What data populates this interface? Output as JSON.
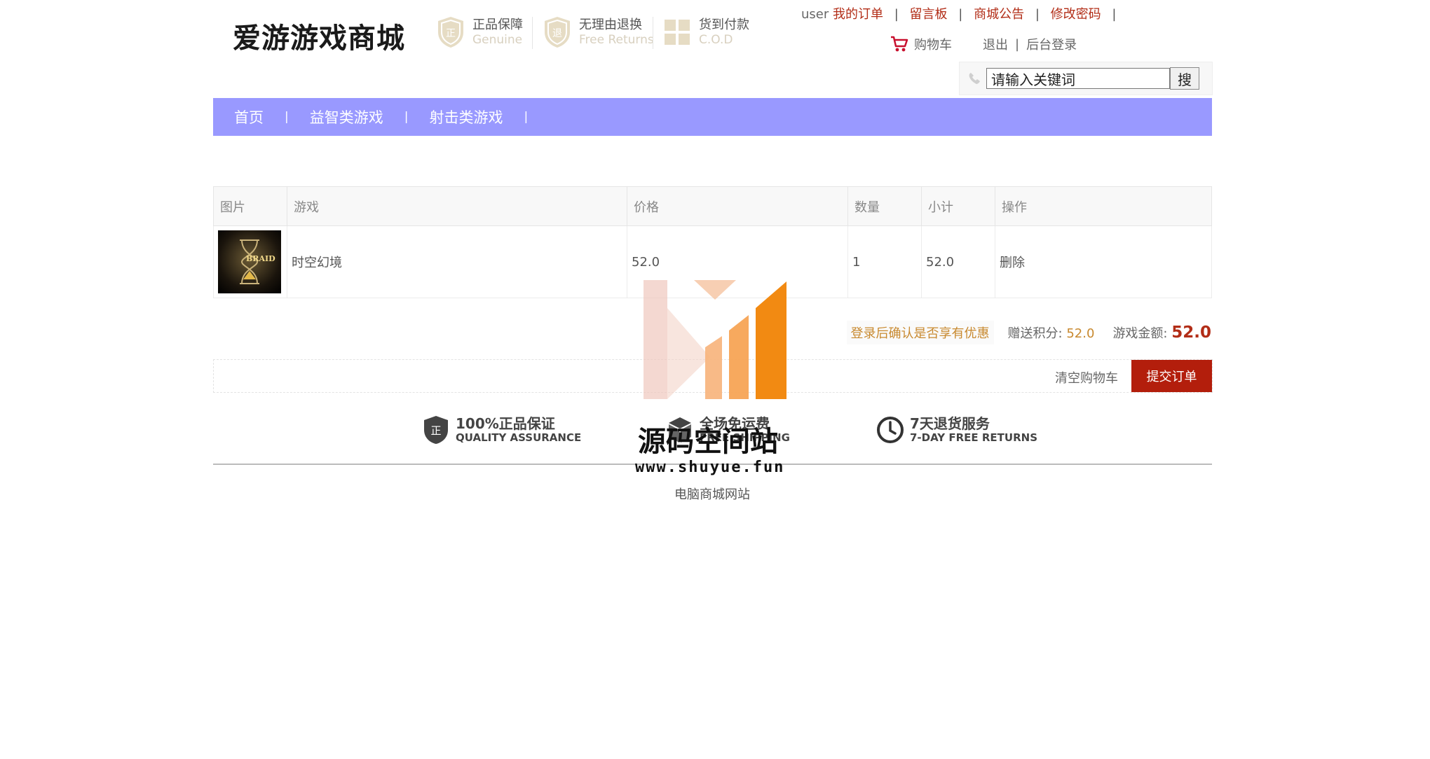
{
  "header": {
    "logo_text": "爱游游戏商城",
    "promises": [
      {
        "title": "正品保障",
        "subtitle": "Genuine"
      },
      {
        "title": "无理由退换",
        "subtitle": "Free Returns"
      },
      {
        "title": "货到付款",
        "subtitle": "C.O.D"
      }
    ],
    "user_links": {
      "username": "user",
      "my_orders": "我的订单",
      "message_board": "留言板",
      "announcements": "商城公告",
      "change_password": "修改密码",
      "separator": "|"
    },
    "cart_label": "购物车",
    "logout": "退出",
    "admin_login": "后台登录"
  },
  "search": {
    "value": "请输入关键词",
    "button_label": "搜"
  },
  "nav": {
    "items": [
      "首页",
      "益智类游戏",
      "射击类游戏"
    ],
    "separator": "|"
  },
  "cart_table": {
    "headers": [
      "图片",
      "游戏",
      "价格",
      "数量",
      "小计",
      "操作"
    ],
    "rows": [
      {
        "image_label": "BRAID",
        "name": "时空幻境",
        "price": "52.0",
        "quantity": "1",
        "subtotal": "52.0",
        "action": "删除"
      }
    ]
  },
  "summary": {
    "promo_text": "登录后确认是否享有优惠",
    "points_label": "赠送积分:",
    "points_value": "52.0",
    "amount_label": "游戏金额:",
    "amount_value": "52.0"
  },
  "actions": {
    "clear_cart": "清空购物车",
    "submit_order": "提交订单"
  },
  "footer": {
    "guarantees": [
      {
        "title": "100%正品保证",
        "subtitle": "QUALITY ASSURANCE"
      },
      {
        "title": "全场免运费",
        "subtitle": "FREE SHIPPING"
      },
      {
        "title": "7天退货服务",
        "subtitle": "7-DAY FREE RETURNS"
      }
    ],
    "site_text": "电脑商城网站"
  },
  "watermark": {
    "title": "源码空间站",
    "url": "www.shuyue.fun"
  },
  "colors": {
    "nav_bg": "#9999ff",
    "link_red": "#b22d17",
    "submit_bg": "#b31e0c",
    "accent_orange": "#c8892f"
  }
}
